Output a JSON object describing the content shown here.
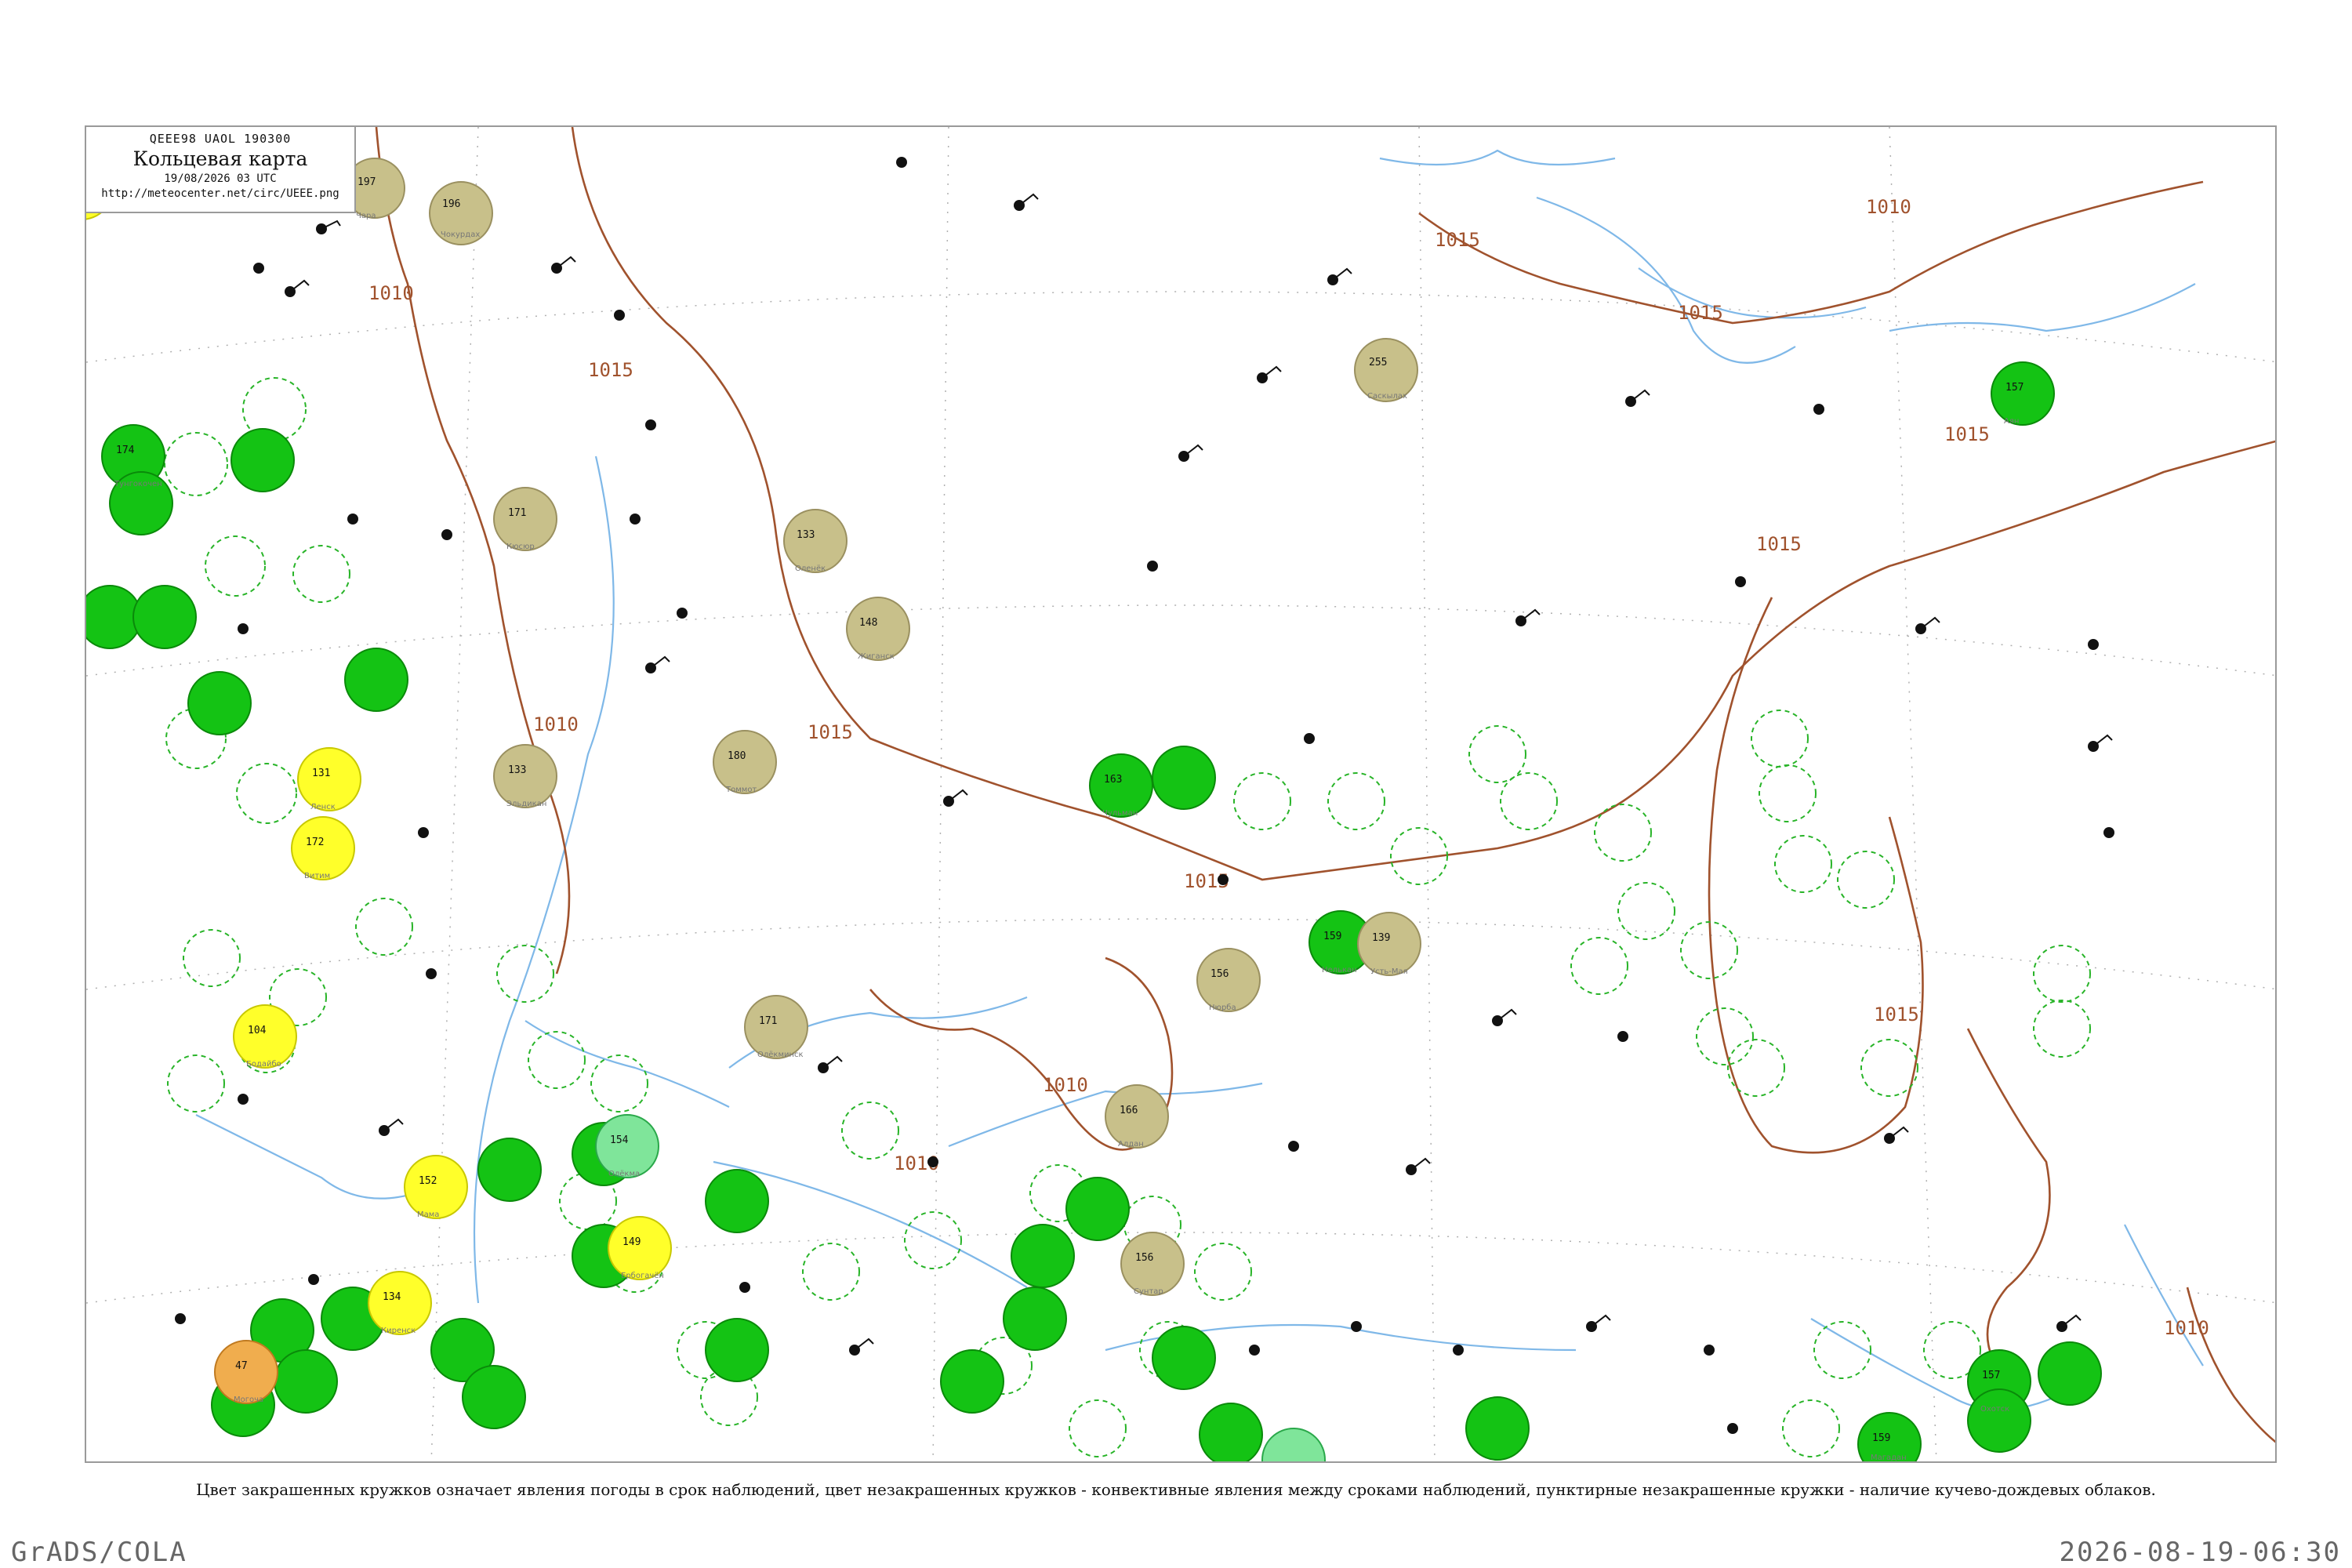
{
  "header": {
    "code_line": "QEEE98 UAOL 190300",
    "title": "Кольцевая карта",
    "date_line": "19/08/2026 03 UTC",
    "url": "http://meteocenter.net/circ/UEEE.png"
  },
  "caption": "Цвет закрашенных кружков означает явления погоды в срок наблюдений, цвет незакрашенных кружков - конвективные явления между сроками наблюдений, пунктирные незакрашенные кружки - наличие кучево-дождевых облаков.",
  "footer": {
    "left": "GrADS/COLA",
    "right": "2026-08-19-06:30"
  },
  "colors": {
    "isobar": "#a0522d",
    "river": "#7fb8e8",
    "rain": "#14c314",
    "drizzle": "#7fe59a",
    "haze": "#c8c08a",
    "fog": "#ffff2a",
    "smoke": "#f0ad4e",
    "cb_dashed": "#28b428",
    "frame": "#9a9a9a"
  },
  "isobar_labels": [
    "1010",
    "1015"
  ],
  "stations": [
    {
      "name": "Чокурдах",
      "value": "196",
      "fill": "haze"
    },
    {
      "name": "Саскылах",
      "value": "255",
      "fill": "haze"
    },
    {
      "name": "Оленёк",
      "value": "133",
      "fill": "haze"
    },
    {
      "name": "Жиганск",
      "value": "148",
      "fill": "haze"
    },
    {
      "name": "Кюсюр",
      "value": "171",
      "fill": "haze"
    },
    {
      "name": "Эльдикан",
      "value": "133",
      "fill": "haze"
    },
    {
      "name": "Томмот",
      "value": "180",
      "fill": "haze"
    },
    {
      "name": "Олёкминск",
      "value": "171",
      "fill": "haze"
    },
    {
      "name": "Алдан",
      "value": "166",
      "fill": "haze"
    },
    {
      "name": "Нюрба",
      "value": "156",
      "fill": "haze"
    },
    {
      "name": "Усть-Мая",
      "value": "139",
      "fill": "haze"
    },
    {
      "name": "Сунтар",
      "value": "156",
      "fill": "haze"
    },
    {
      "name": "Ленск",
      "value": "131",
      "fill": "fog"
    },
    {
      "name": "Витим",
      "value": "172",
      "fill": "fog"
    },
    {
      "name": "Бодайбо",
      "value": "104",
      "fill": "fog"
    },
    {
      "name": "Мама",
      "value": "152",
      "fill": "fog"
    },
    {
      "name": "Киренск",
      "value": "134",
      "fill": "fog"
    },
    {
      "name": "Ербогачён",
      "value": "149",
      "fill": "fog"
    },
    {
      "name": "Чара",
      "value": "197",
      "fill": "fog"
    },
    {
      "name": "Могоча",
      "value": "47",
      "fill": "smoke"
    },
    {
      "name": "Олёкма",
      "value": "154",
      "fill": "drizzle"
    },
    {
      "name": "Тунгокочен",
      "value": "174",
      "fill": "rain"
    },
    {
      "name": "Чульман",
      "value": "163",
      "fill": "rain"
    },
    {
      "name": "Нелькан",
      "value": "159",
      "fill": "rain"
    },
    {
      "name": "Аян",
      "value": "157",
      "fill": "rain"
    },
    {
      "name": "Охотск",
      "value": "157",
      "fill": "rain"
    },
    {
      "name": "Магадан",
      "value": "159",
      "fill": "rain"
    }
  ]
}
